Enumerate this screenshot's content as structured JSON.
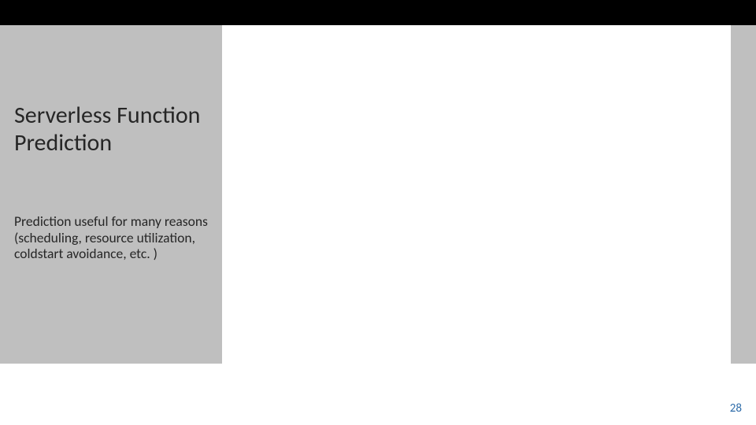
{
  "slide": {
    "title": "Serverless Function Prediction",
    "subtitle": "Prediction useful for many reasons (scheduling, resource utilization, coldstart avoidance, etc. )",
    "page_number": "28"
  },
  "colors": {
    "sidebar_bg": "#bfbfbf",
    "top_bar_bg": "#000000",
    "page_number_color": "#2e6ca9",
    "text_color": "#262626"
  }
}
